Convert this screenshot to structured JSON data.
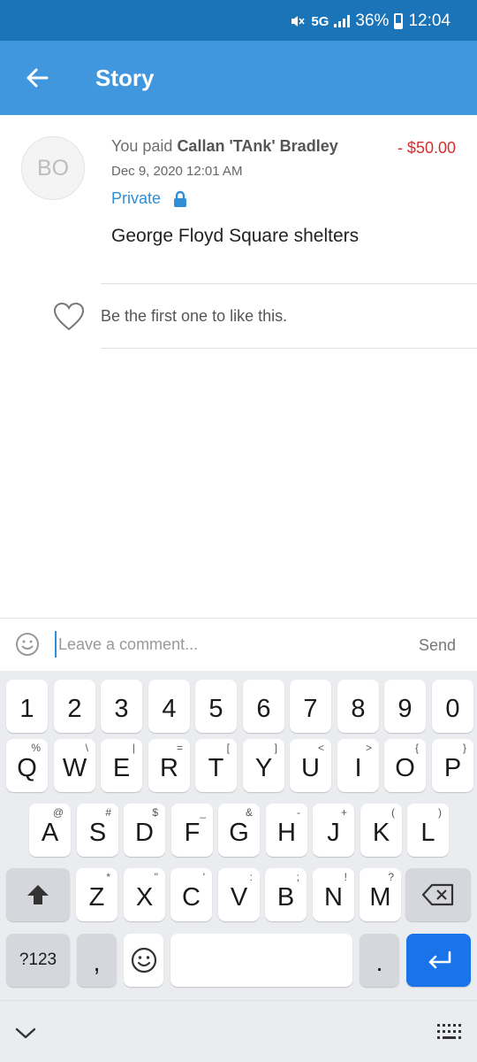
{
  "status_bar": {
    "network": "5G",
    "battery": "36%",
    "time": "12:04"
  },
  "app_bar": {
    "title": "Story"
  },
  "story": {
    "avatar_initials": "BO",
    "payer_prefix": "You paid",
    "payee_name": "Callan 'TAnk' Bradley",
    "amount": "- $50.00",
    "date": "Dec 9, 2020 12:01 AM",
    "privacy": "Private",
    "note": "George Floyd Square shelters"
  },
  "likes": {
    "text": "Be the first one to like this."
  },
  "comment": {
    "placeholder": "Leave a comment...",
    "value": "",
    "send_label": "Send"
  },
  "keyboard": {
    "number_row": [
      "1",
      "2",
      "3",
      "4",
      "5",
      "6",
      "7",
      "8",
      "9",
      "0"
    ],
    "row1": [
      {
        "key": "Q",
        "alt": "%"
      },
      {
        "key": "W",
        "alt": "\\"
      },
      {
        "key": "E",
        "alt": "|"
      },
      {
        "key": "R",
        "alt": "="
      },
      {
        "key": "T",
        "alt": "["
      },
      {
        "key": "Y",
        "alt": "]"
      },
      {
        "key": "U",
        "alt": "<"
      },
      {
        "key": "I",
        "alt": ">"
      },
      {
        "key": "O",
        "alt": "{"
      },
      {
        "key": "P",
        "alt": "}"
      }
    ],
    "row2": [
      {
        "key": "A",
        "alt": "@"
      },
      {
        "key": "S",
        "alt": "#"
      },
      {
        "key": "D",
        "alt": "$"
      },
      {
        "key": "F",
        "alt": "_"
      },
      {
        "key": "G",
        "alt": "&"
      },
      {
        "key": "H",
        "alt": "-"
      },
      {
        "key": "J",
        "alt": "+"
      },
      {
        "key": "K",
        "alt": "("
      },
      {
        "key": "L",
        "alt": ")"
      }
    ],
    "row3": [
      {
        "key": "Z",
        "alt": "*"
      },
      {
        "key": "X",
        "alt": "\""
      },
      {
        "key": "C",
        "alt": "'"
      },
      {
        "key": "V",
        "alt": ":"
      },
      {
        "key": "B",
        "alt": ";"
      },
      {
        "key": "N",
        "alt": "!"
      },
      {
        "key": "M",
        "alt": "?"
      }
    ],
    "symbols_label": "?123",
    "comma_label": ",",
    "period_label": "."
  }
}
